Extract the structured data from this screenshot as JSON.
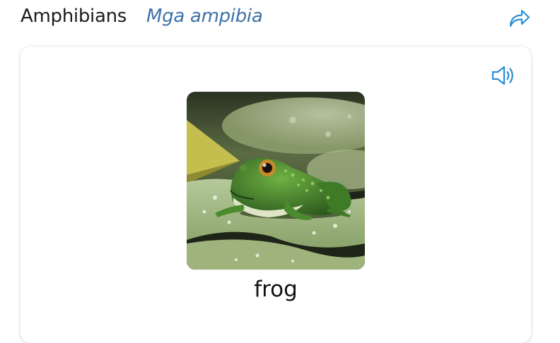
{
  "header": {
    "title": "Amphibians",
    "subtitle": "Mga ampibia",
    "share_icon": "share-arrow-icon"
  },
  "card": {
    "sound_icon": "speaker-icon",
    "image": {
      "subject": "frog"
    },
    "word": "frog"
  },
  "colors": {
    "accent": "#2d8fd5",
    "subtitle": "#3e72a8",
    "text": "#1c1c1e"
  }
}
